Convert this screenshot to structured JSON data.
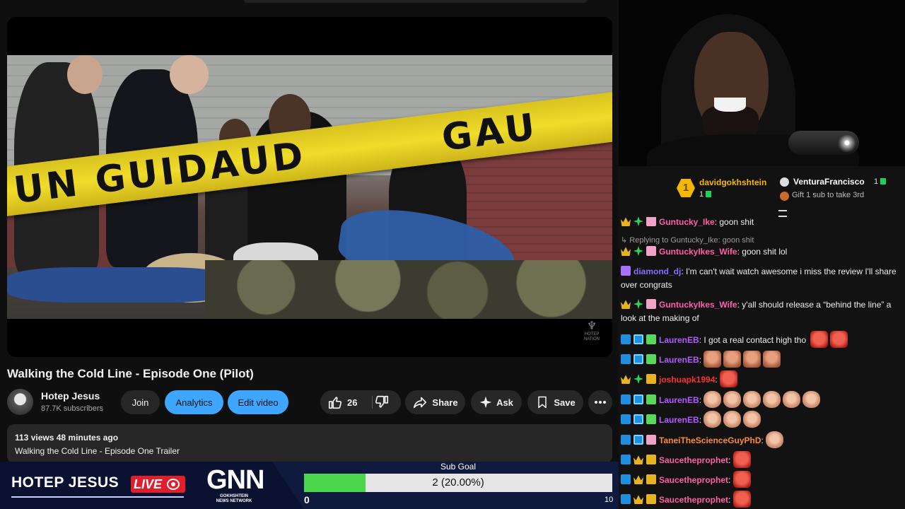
{
  "video": {
    "title": "Walking the Cold Line - Episode One (Pilot)",
    "watermark": "HOTEP NATION",
    "tape_text_left": "UN GUIDAUD",
    "tape_text_right": "GAU"
  },
  "channel": {
    "name": "Hotep Jesus",
    "subscribers": "87.7K subscribers"
  },
  "actions": {
    "join": "Join",
    "analytics": "Analytics",
    "edit": "Edit video",
    "likes": "26",
    "share": "Share",
    "ask": "Ask",
    "save": "Save"
  },
  "description": {
    "meta": "113 views  48 minutes ago",
    "line": "Walking the Cold Line - Episode One Trailer"
  },
  "overlay": {
    "name": "HOTEP JESUS",
    "live": "LIVE",
    "gnn": "GNN",
    "gnn_sub_1": "GOKHSHTEIN",
    "gnn_sub_2": "NEWS NETWORK",
    "subgoal": {
      "title": "Sub Goal",
      "text": "2 (20.00%)",
      "current": 2,
      "goal": 10,
      "fraction": 0.2,
      "min": "0",
      "max": "10"
    }
  },
  "leaderboard": {
    "rank1": "1",
    "first_name": "davidgokhshtein",
    "first_count": "1",
    "second_name": "VenturaFrancisco",
    "second_count": "1",
    "third_text": "Gift 1 sub to take 3rd"
  },
  "chat": [
    {
      "user": "Guntucky_Ike",
      "color": "#ff5ea8",
      "text": ": goon shit"
    },
    {
      "reply": "Replying to Guntucky_Ike: goon shit"
    },
    {
      "user": "GuntuckyIkes_Wife",
      "color": "#ff5ea8",
      "text": ": goon shit lol"
    },
    {
      "user": "diamond_dj",
      "color": "#8a6bff",
      "text": ": I'm can't wait watch awesome i miss the review I'll share over congrats"
    },
    {
      "user": "GuntuckyIkes_Wife",
      "color": "#ff5ea8",
      "text": ": y'all should release a “behind the line” a look at the making of"
    },
    {
      "user": "LaurenEB",
      "color": "#b25bff",
      "text": ": I got a real contact high tho"
    },
    {
      "user": "LaurenEB",
      "color": "#b25bff",
      "text": ":"
    },
    {
      "user": "joshuapk1994",
      "color": "#ff2f2f",
      "text": ":"
    },
    {
      "user": "LaurenEB",
      "color": "#b25bff",
      "text": ":"
    },
    {
      "user": "LaurenEB",
      "color": "#b25bff",
      "text": ":"
    },
    {
      "user": "TaneiTheScienceGuyPhD",
      "color": "#ff8a2b",
      "text": ":"
    },
    {
      "user": "Saucetheprophet",
      "color": "#ff5ea8",
      "text": ":"
    },
    {
      "user": "Saucetheprophet",
      "color": "#ff5ea8",
      "text": ":"
    },
    {
      "user": "Saucetheprophet",
      "color": "#ff5ea8",
      "text": ":"
    }
  ],
  "colors": {
    "accent_blue": "#3ea6ff",
    "live_red": "#e01e2c",
    "goal_green": "#4cd64c",
    "gold": "#f5b800"
  }
}
